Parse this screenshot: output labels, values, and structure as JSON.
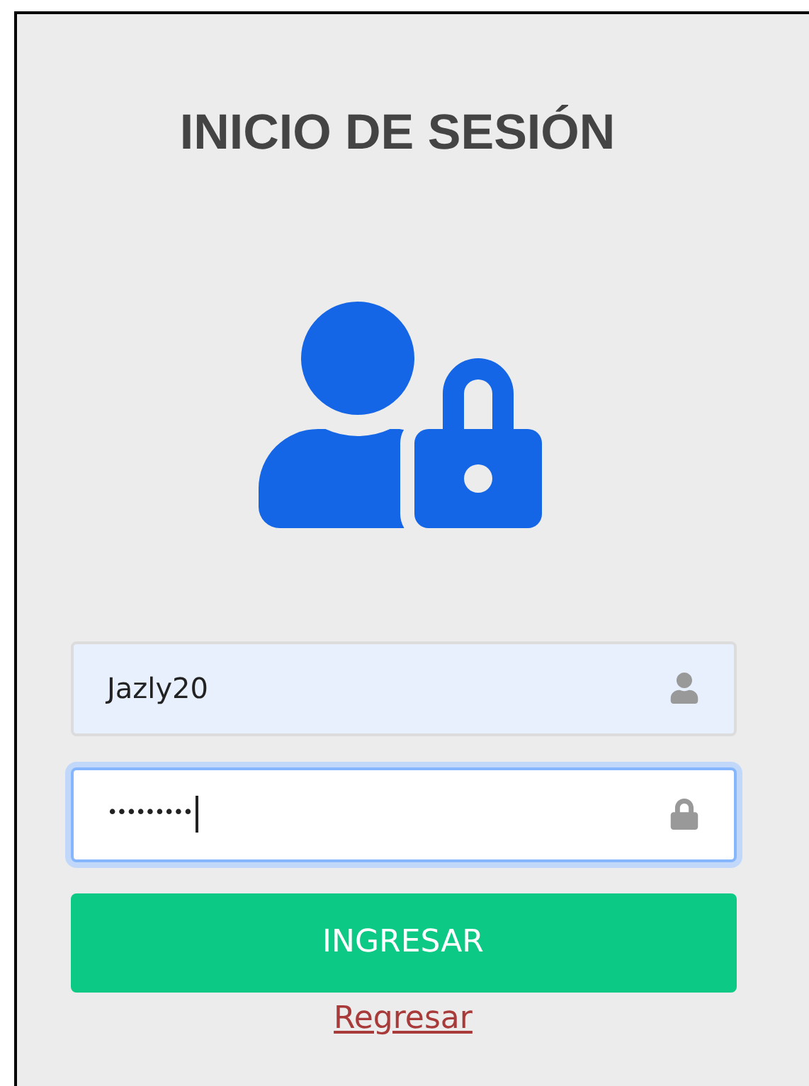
{
  "title": "INICIO DE SESIÓN",
  "fields": [
    {
      "kind": "user",
      "value": "Jazly20",
      "focused": false,
      "autofilled": true
    },
    {
      "kind": "password",
      "value": "•••••••••",
      "focused": true,
      "autofilled": false
    }
  ],
  "button": "INGRESAR",
  "link": "Regresar"
}
